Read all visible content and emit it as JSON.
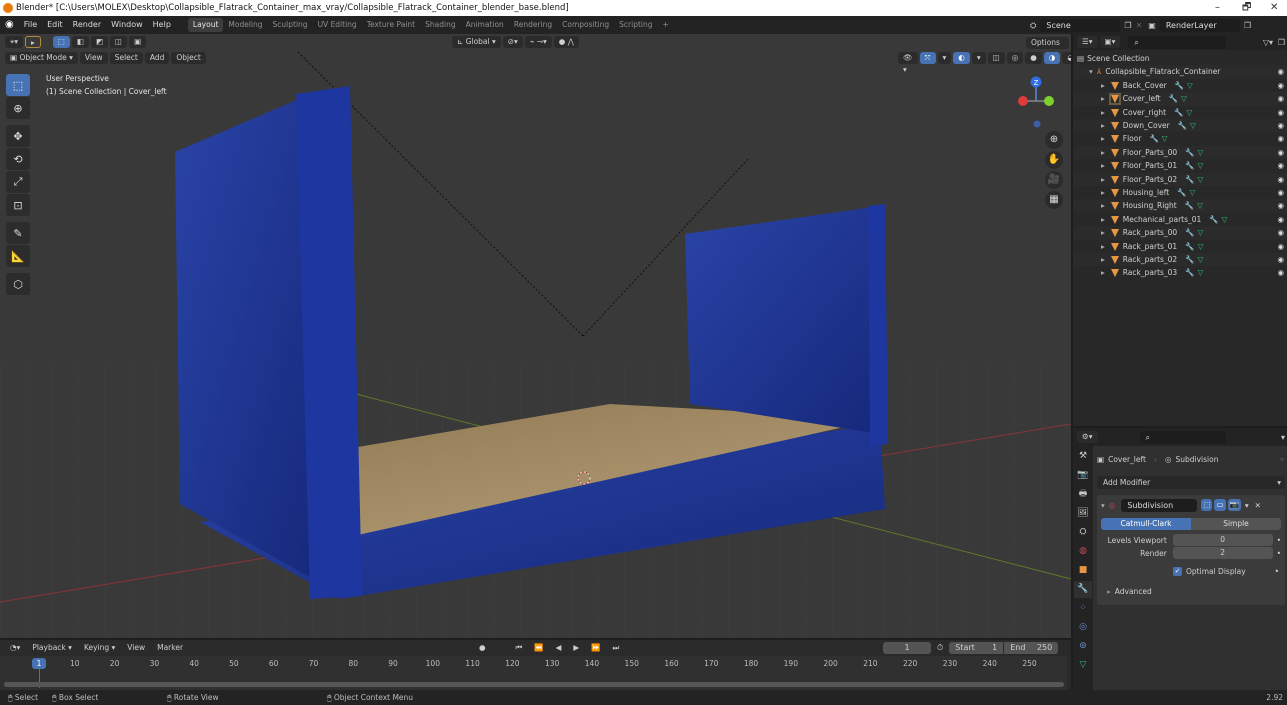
{
  "window": {
    "title": "Blender* [C:\\Users\\MOLEX\\Desktop\\Collapsible_Flatrack_Container_max_vray/Collapsible_Flatrack_Container_blender_base.blend]",
    "controls": {
      "minimize": "–",
      "maximize": "🗗",
      "close": "✕"
    }
  },
  "topbar": {
    "menus": [
      "File",
      "Edit",
      "Render",
      "Window",
      "Help"
    ],
    "workspaces": [
      "Layout",
      "Modeling",
      "Sculpting",
      "UV Editing",
      "Texture Paint",
      "Shading",
      "Animation",
      "Rendering",
      "Compositing",
      "Scripting"
    ],
    "active_workspace": "Layout",
    "add_workspace": "+",
    "scene_label": "Scene",
    "view_layer_label": "RenderLayer"
  },
  "viewport": {
    "mode": "Object Mode",
    "menus": [
      "View",
      "Select",
      "Add",
      "Object"
    ],
    "transform_orientation": "Global",
    "options_label": "Options",
    "perspective_label": "User Perspective",
    "collection_label": "(1) Scene Collection | Cover_left",
    "gizmo_axis_label": "Z",
    "tools": [
      "select-box",
      "cursor",
      "move",
      "rotate",
      "scale",
      "transform",
      "annotate",
      "measure",
      "add-cube"
    ],
    "nav_buttons": [
      "zoom",
      "pan",
      "camera",
      "perspective-toggle"
    ],
    "colors": {
      "background": "#393939",
      "container": "#1d3a9c",
      "floor": "#a68d63",
      "x_axis": "#a33a3a",
      "y_axis": "#6c8a2d"
    }
  },
  "outliner": {
    "search_placeholder": "",
    "root": "Scene Collection",
    "collection": "Collapsible_Flatrack_Container",
    "objects": [
      {
        "name": "Back_Cover"
      },
      {
        "name": "Cover_left",
        "selected": true
      },
      {
        "name": "Cover_right"
      },
      {
        "name": "Down_Cover"
      },
      {
        "name": "Floor"
      },
      {
        "name": "Floor_Parts_00"
      },
      {
        "name": "Floor_Parts_01"
      },
      {
        "name": "Floor_Parts_02"
      },
      {
        "name": "Housing_left"
      },
      {
        "name": "Housing_Right"
      },
      {
        "name": "Mechanical_parts_01"
      },
      {
        "name": "Rack_parts_00"
      },
      {
        "name": "Rack_parts_01"
      },
      {
        "name": "Rack_parts_02"
      },
      {
        "name": "Rack_parts_03"
      }
    ]
  },
  "properties": {
    "breadcrumb_object": "Cover_left",
    "breadcrumb_modifier": "Subdivision",
    "add_modifier_label": "Add Modifier",
    "modifier_name": "Subdivision",
    "type_options": [
      "Catmull-Clark",
      "Simple"
    ],
    "active_type": "Catmull-Clark",
    "levels_viewport_label": "Levels Viewport",
    "levels_viewport_value": "0",
    "render_label": "Render",
    "render_value": "2",
    "optimal_display_label": "Optimal Display",
    "optimal_display_checked": true,
    "advanced_label": "Advanced"
  },
  "timeline": {
    "menus": [
      "Playback",
      "Keying",
      "View",
      "Marker"
    ],
    "current_frame": "1",
    "start_label": "Start",
    "start_value": "1",
    "end_label": "End",
    "end_value": "250",
    "ticks": [
      "10",
      "20",
      "30",
      "40",
      "50",
      "60",
      "70",
      "80",
      "90",
      "100",
      "110",
      "120",
      "130",
      "140",
      "150",
      "160",
      "170",
      "180",
      "190",
      "200",
      "210",
      "220",
      "230",
      "240",
      "250"
    ],
    "playback_controls": [
      "⏮",
      "⏪",
      "◀",
      "▶",
      "⏩",
      "⏭"
    ]
  },
  "statusbar": {
    "items": [
      "Select",
      "Box Select",
      "Rotate View",
      "Object Context Menu"
    ],
    "version": "2.92"
  }
}
